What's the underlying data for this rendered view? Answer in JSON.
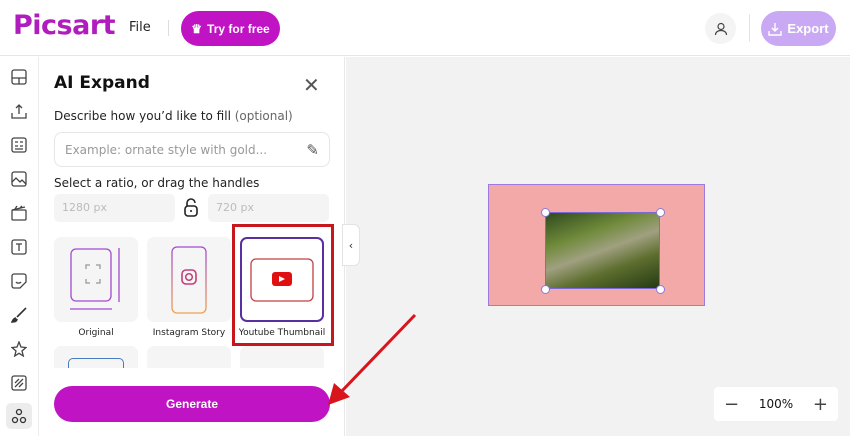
{
  "header": {
    "logo": "Picsart",
    "file": "File",
    "try": "Try for free",
    "export": "Export"
  },
  "panel": {
    "title": "AI Expand",
    "describe_label": "Describe how you’d like to fill",
    "optional": "(optional)",
    "prompt_placeholder": "Example: ornate style with gold...",
    "ratio_label": "Select a ratio, or drag the handles",
    "width_placeholder": "1280 px",
    "height_placeholder": "720 px",
    "ratios": [
      {
        "label": "Original"
      },
      {
        "label": "Instagram Story"
      },
      {
        "label": "Youtube Thumbnail",
        "selected": true
      }
    ],
    "generate": "Generate"
  },
  "zoom": {
    "level": "100%"
  },
  "colors": {
    "brand": "#c013c4",
    "export": "#c9a9f3",
    "highlight": "#c8161d"
  }
}
